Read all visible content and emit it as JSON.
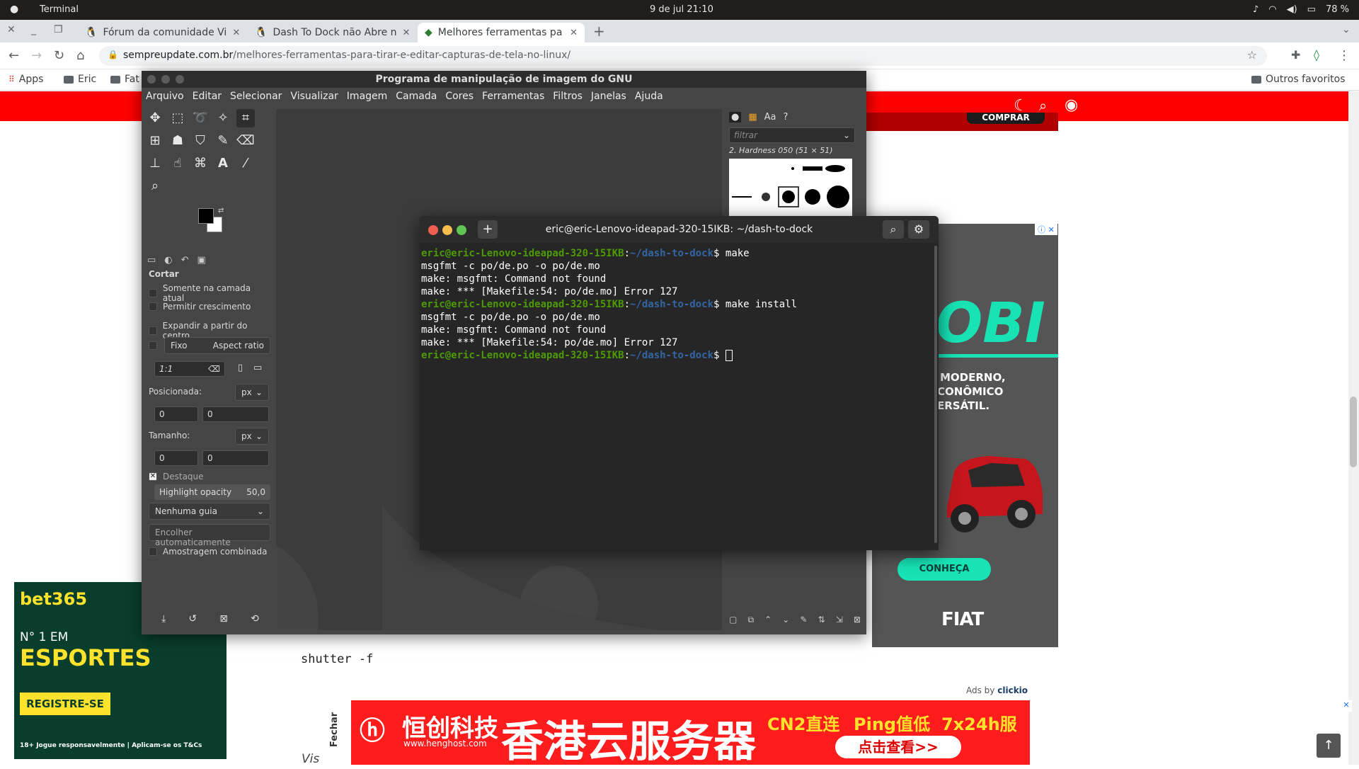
{
  "panel": {
    "app": "Terminal",
    "clock": "9 de jul  21:10",
    "battery": "78 %"
  },
  "chrome": {
    "tabs": [
      {
        "title": "Fórum da comunidade Vi"
      },
      {
        "title": "Dash To Dock não Abre n"
      },
      {
        "title": "Melhores ferramentas pa"
      }
    ],
    "url_host": "sempreupdate.com.br",
    "url_path": "/melhores-ferramentas-para-tirar-e-editar-capturas-de-tela-no-linux/",
    "bookmarks": [
      "Apps",
      "Eric",
      "Fat"
    ],
    "other_favorites": "Outros favoritos"
  },
  "gimp": {
    "title": "Programa de manipulação de imagem do GNU",
    "menu": [
      "Arquivo",
      "Editar",
      "Selecionar",
      "Visualizar",
      "Imagem",
      "Camada",
      "Cores",
      "Ferramentas",
      "Filtros",
      "Janelas",
      "Ajuda"
    ],
    "tool_title": "Cortar",
    "options": {
      "current_layer": "Somente na camada atual",
      "allow_growing": "Permitir crescimento",
      "expand_center": "Expandir a partir do centro",
      "fixed": "Fixo",
      "aspect": "Aspect ratio",
      "ratio": "1:1",
      "position_label": "Posicionada:",
      "size_label": "Tamanho:",
      "unit": "px",
      "pos_x": "0",
      "pos_y": "0",
      "size_w": "0",
      "size_h": "0",
      "highlight": "Destaque",
      "highlight_opacity_label": "Highlight opacity",
      "highlight_opacity": "50,0",
      "guide": "Nenhuma guia",
      "auto_shrink": "Encolher automaticamente",
      "sample_merged": "Amostragem combinada"
    },
    "brush_filter": "filtrar",
    "brush_name": "2. Hardness 050 (51 × 51)"
  },
  "terminal": {
    "title": "eric@eric-Lenovo-ideapad-320-15IKB: ~/dash-to-dock",
    "user": "eric@eric-Lenovo-ideapad-320-15IKB",
    "path": "~/dash-to-dock",
    "lines": [
      {
        "prompt": true,
        "cmd": "make"
      },
      {
        "prompt": false,
        "text": "msgfmt -c po/de.po -o po/de.mo"
      },
      {
        "prompt": false,
        "text": "make: msgfmt: Command not found"
      },
      {
        "prompt": false,
        "text": "make: *** [Makefile:54: po/de.mo] Error 127"
      },
      {
        "prompt": true,
        "cmd": "make install"
      },
      {
        "prompt": false,
        "text": "msgfmt -c po/de.po -o po/de.mo"
      },
      {
        "prompt": false,
        "text": "make: msgfmt: Command not found"
      },
      {
        "prompt": false,
        "text": "make: *** [Makefile:54: po/de.mo] Error 127"
      },
      {
        "prompt": true,
        "cmd": ""
      }
    ]
  },
  "page": {
    "shutter_cmd": "shutter -f",
    "vis": "Vis",
    "ads_by": "Ads by",
    "ads_brand": "clickio",
    "buy": "COMPRAR"
  },
  "ads": {
    "fiat": {
      "headline": "OBI",
      "tag1": "MODERNO,",
      "tag2": "CONÔMICO",
      "tag3": "ERSÁTIL.",
      "cta": "CONHEÇA",
      "brand": "FIAT"
    },
    "bet": {
      "brand": "bet365",
      "line1": "N° 1 EM",
      "line2": "ESPORTES",
      "cta": "REGISTRE-SE",
      "footer": "18+ Jogue responsavelmente | Aplicam-se os T&Cs"
    },
    "heng": {
      "close": "Fechar",
      "brand": "恒创科技",
      "site": "www.henghost.com",
      "headline": "香港云服务器",
      "f1": "CN2直连",
      "f2": "Ping值低",
      "f3": "7x24h服务",
      "cta": "点击查看>>"
    }
  }
}
